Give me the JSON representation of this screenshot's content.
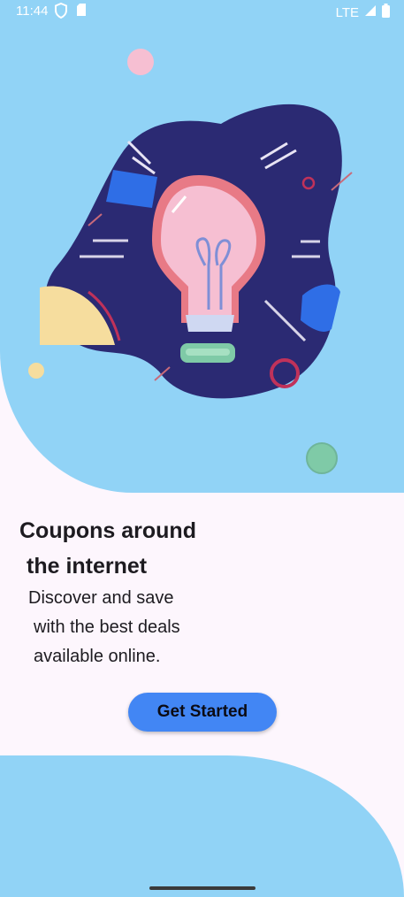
{
  "status_bar": {
    "time": "11:44",
    "network": "LTE",
    "icons": [
      "shield-icon",
      "sim-card-icon",
      "signal-icon",
      "battery-icon"
    ]
  },
  "illustration": {
    "subject": "lightbulb-illustration",
    "colors": {
      "background": "#91d3f6",
      "blob": "#2b2a73",
      "bulb": "#f6bfd2",
      "accent_blue": "#2f6ee6",
      "accent_yellow": "#f6dd9e",
      "accent_green": "#7fcaa7"
    }
  },
  "onboarding": {
    "title_line1": "Coupons around",
    "title_line2": "the internet",
    "description_line1": "Discover and save",
    "description_line2": "with the best deals",
    "description_line3": "available online.",
    "cta_label": "Get Started"
  },
  "colors": {
    "page_background": "#fdf6fd",
    "shape_blue": "#91d3f6",
    "button": "#4286f4",
    "text": "#1d1b20"
  }
}
